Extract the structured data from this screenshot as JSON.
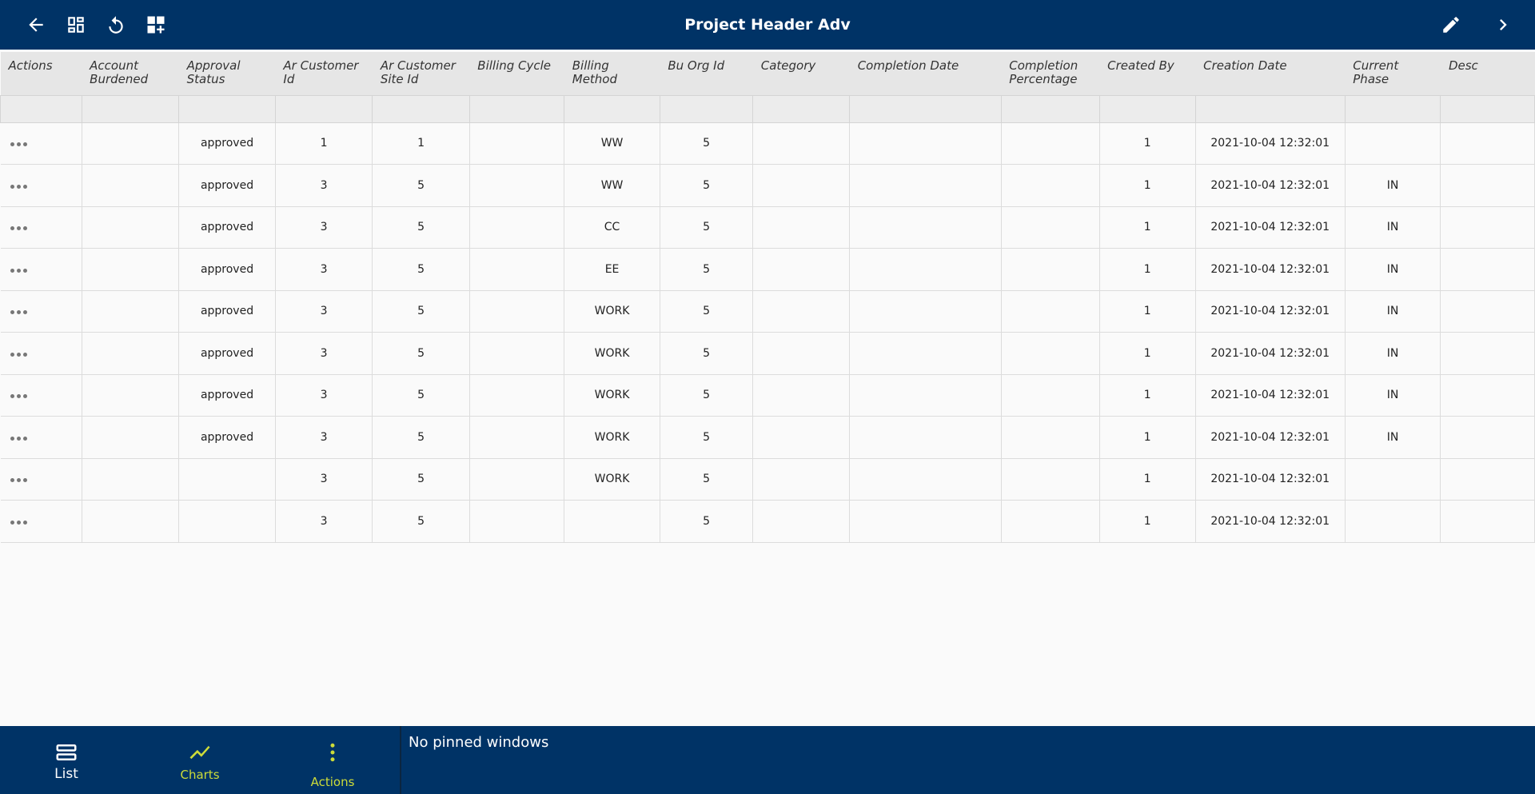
{
  "header": {
    "title": "Project Header  Adv",
    "icons": [
      "arrow-back-icon",
      "dashboard-icon",
      "refresh-icon",
      "add-widget-icon",
      "edit-pencil-icon",
      "chevron-right-icon"
    ]
  },
  "table": {
    "columns": [
      "Actions",
      "Account Burdened",
      "Approval Status",
      "Ar Customer Id",
      "Ar Customer Site Id",
      "Billing Cycle",
      "Billing Method",
      "Bu Org Id",
      "Category",
      "Completion Date",
      "Completion Percentage",
      "Created By",
      "Creation Date",
      "Current Phase",
      "Desc"
    ],
    "rows": [
      [
        "",
        "",
        "approved",
        "1",
        "1",
        "",
        "WW",
        "5",
        "",
        "",
        "",
        "1",
        "2021-10-04 12:32:01",
        "",
        ""
      ],
      [
        "",
        "",
        "approved",
        "3",
        "5",
        "",
        "WW",
        "5",
        "",
        "",
        "",
        "1",
        "2021-10-04 12:32:01",
        "IN",
        ""
      ],
      [
        "",
        "",
        "approved",
        "3",
        "5",
        "",
        "CC",
        "5",
        "",
        "",
        "",
        "1",
        "2021-10-04 12:32:01",
        "IN",
        ""
      ],
      [
        "",
        "",
        "approved",
        "3",
        "5",
        "",
        "EE",
        "5",
        "",
        "",
        "",
        "1",
        "2021-10-04 12:32:01",
        "IN",
        ""
      ],
      [
        "",
        "",
        "approved",
        "3",
        "5",
        "",
        "WORK",
        "5",
        "",
        "",
        "",
        "1",
        "2021-10-04 12:32:01",
        "IN",
        ""
      ],
      [
        "",
        "",
        "approved",
        "3",
        "5",
        "",
        "WORK",
        "5",
        "",
        "",
        "",
        "1",
        "2021-10-04 12:32:01",
        "IN",
        ""
      ],
      [
        "",
        "",
        "approved",
        "3",
        "5",
        "",
        "WORK",
        "5",
        "",
        "",
        "",
        "1",
        "2021-10-04 12:32:01",
        "IN",
        ""
      ],
      [
        "",
        "",
        "approved",
        "3",
        "5",
        "",
        "WORK",
        "5",
        "",
        "",
        "",
        "1",
        "2021-10-04 12:32:01",
        "IN",
        ""
      ],
      [
        "",
        "",
        "",
        "3",
        "5",
        "",
        "WORK",
        "5",
        "",
        "",
        "",
        "1",
        "2021-10-04 12:32:01",
        "",
        ""
      ],
      [
        "",
        "",
        "",
        "3",
        "5",
        "",
        "",
        "5",
        "",
        "",
        "",
        "1",
        "2021-10-04 12:32:01",
        "",
        ""
      ]
    ]
  },
  "bottom_nav": {
    "list_label": "List",
    "charts_label": "Charts",
    "actions_label": "Actions",
    "pinned_text": "No pinned windows",
    "icons": [
      "list-view-icon",
      "chart-line-icon",
      "more-vert-icon"
    ]
  },
  "colors": {
    "header_bg": "#003366",
    "accent": "#cddc39",
    "white": "#ffffff"
  }
}
